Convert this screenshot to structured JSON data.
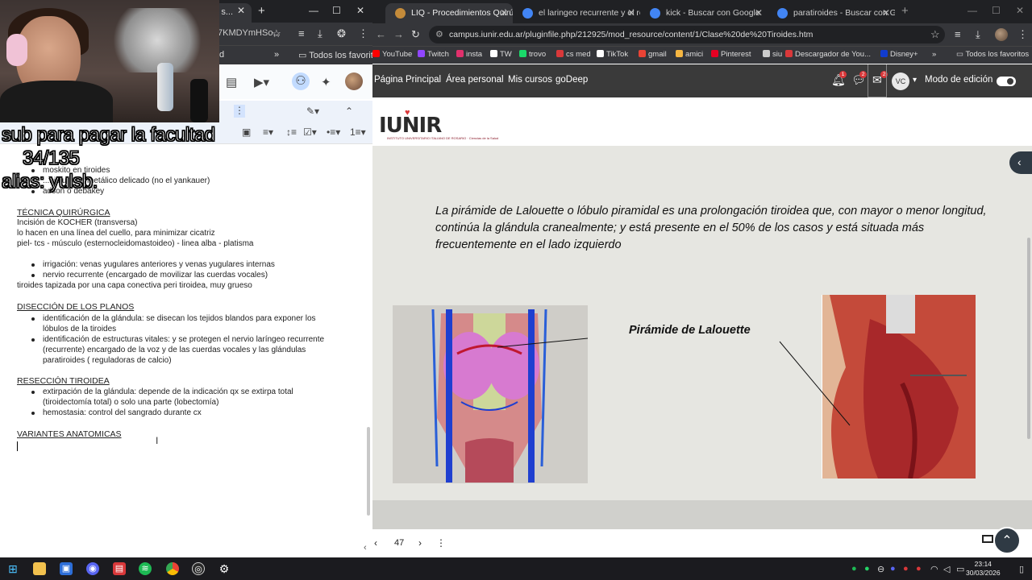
{
  "left_window": {
    "tab_title": "nto s...",
    "url_fragment": "7KMDYmHSo...",
    "bookmark_label": "d",
    "bookmarks_all": "Todos los favoritos"
  },
  "doc": {
    "lines_top": [
      "moskito en tiroides",
      "...bisturí ...n metálico delicado (no el yankauer)",
      "adson o debakey"
    ],
    "section1_title": "TÉCNICA QUIRÚRGICA",
    "section1_lines": [
      "Incisión de KOCHER (transversa)",
      "lo hacen en una línea del cuello, para minimizar cicatriz",
      "piel- tcs - músculo (esternocleidomastoideo) - linea alba - platisma"
    ],
    "section1_bullets": [
      "irrigación: venas yugulares anteriores y venas yugulares internas",
      "nervio recurrente (encargado de movilizar las cuerdas vocales)"
    ],
    "section1_after": "tiroides tapizada por una capa conectiva peri tiroidea, muy grueso",
    "section2_title": "DISECCIÓN DE LOS PLANOS",
    "section2_bullets": [
      "identificación de la glándula: se disecan los tejidos blandos para exponer los lóbulos de la tiroides",
      "identificación de estructuras vitales: y se protegen el nervio laríngeo recurrente (recurrente) encargado de la voz y de las cuerdas vocales y las glándulas paratiroides ( reguladoras de calcio)"
    ],
    "section3_title": "RESECCIÓN TIROIDEA",
    "section3_bullets": [
      "extirpación de la glándula: depende de la indicación qx se extirpa total (tiroidectomía total) o solo una parte (lobectomía)",
      "hemostasia: control del sangrado durante cx"
    ],
    "section4_title": "VARIANTES ANATOMICAS"
  },
  "overlay": {
    "line1": "sub para pagar la facultad",
    "line2": "34/135",
    "line3": "alias: yulsb."
  },
  "right_window": {
    "tabs": [
      {
        "label": "LIQ - Procedimientos Quirúrgic...",
        "active": true
      },
      {
        "label": "el laringeo recurrente y el recu...",
        "active": false
      },
      {
        "label": "kick - Buscar con Google",
        "active": false
      },
      {
        "label": "paratiroides - Buscar con Goog...",
        "active": false
      }
    ],
    "url": "campus.iunir.edu.ar/pluginfile.php/212925/mod_resource/content/1/Clase%20de%20Tiroides.htm",
    "bookmarks": [
      {
        "label": "Todos los favoritos",
        "color": "#e8c15a"
      },
      {
        "label": "YouTube",
        "color": "#ff0000"
      },
      {
        "label": "Twitch",
        "color": "#9146ff"
      },
      {
        "label": "insta",
        "color": "#e1306c"
      },
      {
        "label": "TW",
        "color": "#ffffff"
      },
      {
        "label": "trovo",
        "color": "#1bd96a"
      },
      {
        "label": "cs med",
        "color": "#d9383a"
      },
      {
        "label": "TikTok",
        "color": "#ffffff"
      },
      {
        "label": "gmail",
        "color": "#ea4335"
      },
      {
        "label": "amici",
        "color": "#f5b642"
      },
      {
        "label": "Pinterest",
        "color": "#e60023"
      },
      {
        "label": "siu",
        "color": "#cccccc"
      },
      {
        "label": "Descargador de You...",
        "color": "#d9383a"
      },
      {
        "label": "Disney+",
        "color": "#113ccf"
      }
    ],
    "bookmarks_all_right": "Todos los favoritos",
    "nav_links": [
      "Página Principal",
      "Área personal",
      "Mis cursos",
      "goDeep"
    ],
    "badges": [
      "1",
      "2",
      "2"
    ],
    "avatar_initials": "VC",
    "edit_mode": "Modo de edición"
  },
  "slide": {
    "logo": "IUNIR",
    "logo_sub": "INSTITUTO UNIVERSITARIO ITALIANO DE ROSARIO · Ciencias de la Salud",
    "text": "La pirámide de Lalouette o lóbulo piramidal es una prolongación tiroidea que, con mayor o menor longitud, continúa la glándula cranealmente; y está presente en el 50% de los casos y está situada más frecuentemente en el lado izquierdo",
    "label": "Pirámide de Lalouette",
    "page": "47"
  },
  "taskbar": {
    "time": "23:14",
    "date": "30/03/2026"
  }
}
